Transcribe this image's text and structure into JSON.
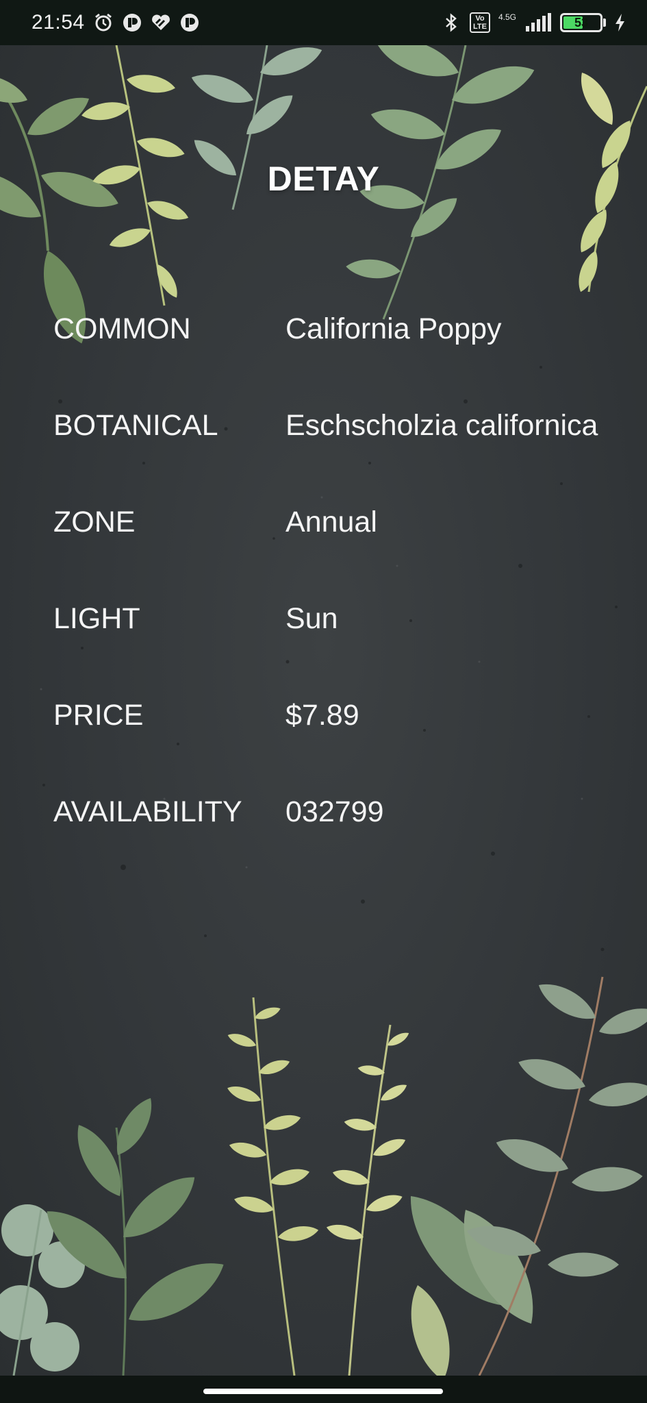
{
  "status_bar": {
    "time": "21:54",
    "network_type": "4.5G",
    "volte_label": "Vo\nLTE",
    "battery_level": "53",
    "battery_fraction": 0.53,
    "icons": [
      "alarm-icon",
      "notification-app-icon",
      "heart-app-icon",
      "notification-app-icon-2",
      "bluetooth-icon",
      "volte-icon",
      "signal-icon",
      "battery-icon",
      "charging-icon"
    ]
  },
  "page": {
    "title": "DETAY"
  },
  "details": [
    {
      "label": "COMMON",
      "value": "California Poppy"
    },
    {
      "label": "BOTANICAL",
      "value": "Eschscholzia californica"
    },
    {
      "label": "ZONE",
      "value": "Annual"
    },
    {
      "label": "LIGHT",
      "value": "Sun"
    },
    {
      "label": "PRICE",
      "value": "$7.89"
    },
    {
      "label": "AVAILABILITY",
      "value": "032799"
    }
  ],
  "colors": {
    "background": "#33373a",
    "status_bar": "#101814",
    "leaf_green": "#7f9a6e",
    "leaf_sage": "#9db3a0",
    "leaf_yellow": "#d4d99a",
    "battery_fill": "#4cd964"
  }
}
